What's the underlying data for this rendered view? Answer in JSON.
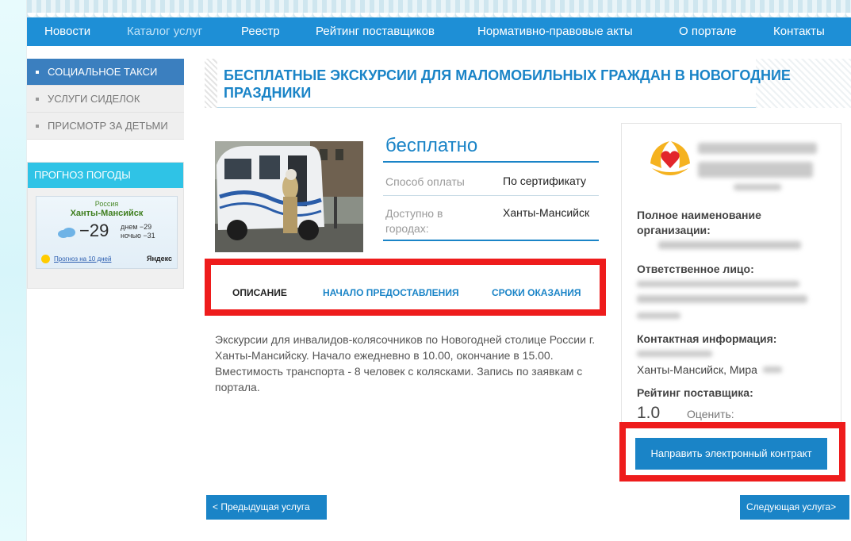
{
  "nav": {
    "items": [
      "Новости",
      "Каталог услуг",
      "Реестр",
      "Рейтинг поставщиков",
      "Нормативно-правовые акты",
      "О портале",
      "Контакты"
    ]
  },
  "sidebar": {
    "items": [
      "СОЦИАЛЬНОЕ ТАКСИ",
      "УСЛУГИ СИДЕЛОК",
      "ПРИСМОТР ЗА ДЕТЬМИ"
    ],
    "active_item": "СОЦИАЛЬНОЕ ТАКСИ"
  },
  "weather": {
    "title": "ПРОГНОЗ ПОГОДЫ",
    "country": "Россия",
    "city": "Ханты-Мансийск",
    "temp": "−29",
    "day": "днем −29",
    "night": "ночью −31",
    "forecast_link": "Прогноз на 10 дней",
    "brand": "Яндекс"
  },
  "service": {
    "title": "БЕСПЛАТНЫЕ ЭКСКУРСИИ ДЛЯ МАЛОМОБИЛЬНЫХ ГРАЖДАН В НОВОГОДНИЕ ПРАЗДНИКИ",
    "price": "бесплатно",
    "payment_label": "Способ оплаты",
    "payment_value": "По сертификату",
    "cities_label": "Доступно в городах:",
    "cities_value": "Ханты-Мансийск",
    "description": "Экскурсии для инвалидов-колясочников по Новогодней столице России г. Ханты-Мансийску. Начало ежедневно в 10.00, окончание в 15.00. Вместимость транспорта - 8 человек с колясками. Запись по заявкам с портала."
  },
  "tabs": [
    {
      "label": "ОПИСАНИЕ",
      "active": true
    },
    {
      "label": "НАЧАЛО ПРЕДОСТАВЛЕНИЯ",
      "active": false
    },
    {
      "label": "СРОКИ ОКАЗАНИЯ",
      "active": false
    }
  ],
  "provider": {
    "full_name_label": "Полное наименование организации:",
    "responsible_label": "Ответственное лицо:",
    "contact_label": "Контактная информация:",
    "address": "Ханты-Мансийск, Мира",
    "rating_label": "Рейтинг поставщика:",
    "rating_value": "1.0",
    "rate_label": "Оценить:",
    "contract_button": "Направить электронный контракт"
  },
  "pager": {
    "prev": "< Предыдущая услуга",
    "next": "Следующая услуга>"
  },
  "colors": {
    "accent": "#1a84c7",
    "nav": "#1e8fd6",
    "highlight": "#ee1c1c",
    "sidebar_active": "#3b7fbf",
    "weather_header": "#2fc3e6"
  },
  "icons": {
    "logo": "heart-hands-icon",
    "weather": "cloud-icon"
  }
}
